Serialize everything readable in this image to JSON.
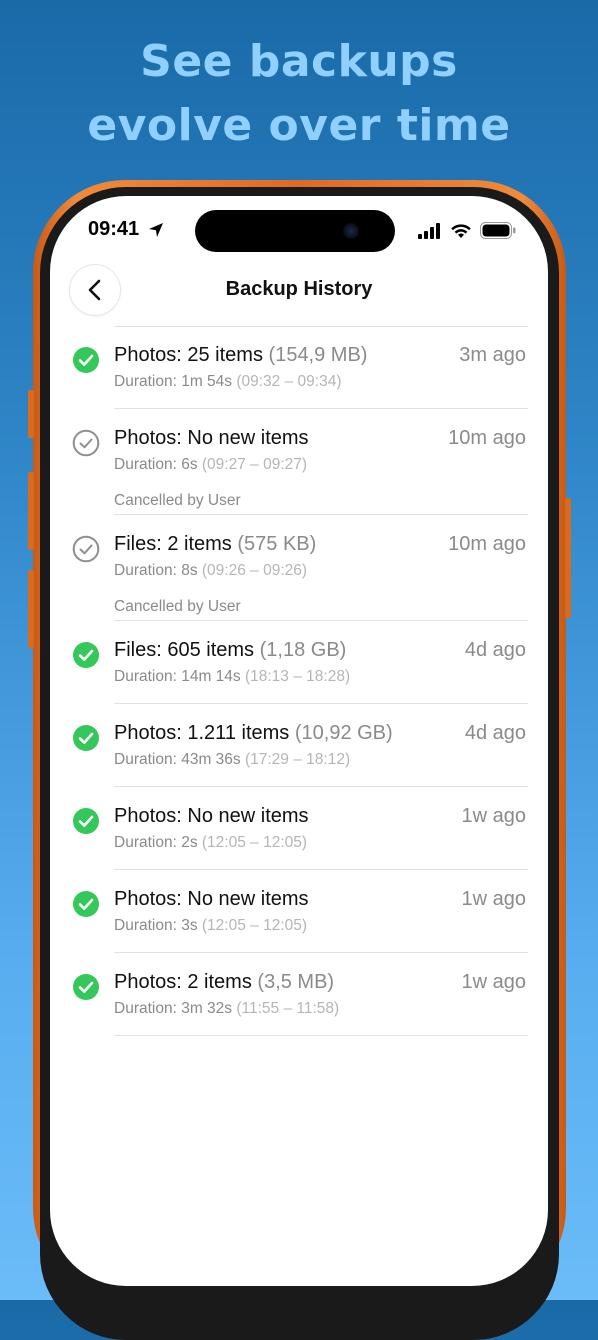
{
  "headline": {
    "line1": "See backups",
    "line2": "evolve over time"
  },
  "status_bar": {
    "time": "09:41",
    "icons": [
      "location-arrow-icon",
      "cellular-signal-icon",
      "wifi-icon",
      "battery-icon"
    ]
  },
  "nav": {
    "back_icon": "chevron-left-icon",
    "title": "Backup History"
  },
  "colors": {
    "success": "#34c759",
    "cancelled": "#8e8e93",
    "phone_frame": "#e9782c",
    "headline": "#8fd0ff"
  },
  "history": [
    {
      "status": "success",
      "title": "Photos: 25 items",
      "size": "(154,9 MB)",
      "ago": "3m ago",
      "duration": "Duration: 1m 54s",
      "range": "(09:32 – 09:34)",
      "note": ""
    },
    {
      "status": "cancelled",
      "title": "Photos: No new items",
      "size": "",
      "ago": "10m ago",
      "duration": "Duration: 6s",
      "range": "(09:27 – 09:27)",
      "note": "Cancelled by User"
    },
    {
      "status": "cancelled",
      "title": "Files: 2 items",
      "size": "(575 KB)",
      "ago": "10m ago",
      "duration": "Duration: 8s",
      "range": "(09:26 – 09:26)",
      "note": "Cancelled by User"
    },
    {
      "status": "success",
      "title": "Files: 605 items",
      "size": "(1,18 GB)",
      "ago": "4d ago",
      "duration": "Duration: 14m 14s",
      "range": "(18:13 – 18:28)",
      "note": ""
    },
    {
      "status": "success",
      "title": "Photos: 1.211 items",
      "size": "(10,92 GB)",
      "ago": "4d ago",
      "duration": "Duration: 43m 36s",
      "range": "(17:29 – 18:12)",
      "note": ""
    },
    {
      "status": "success",
      "title": "Photos: No new items",
      "size": "",
      "ago": "1w ago",
      "duration": "Duration: 2s",
      "range": "(12:05 – 12:05)",
      "note": ""
    },
    {
      "status": "success",
      "title": "Photos: No new items",
      "size": "",
      "ago": "1w ago",
      "duration": "Duration: 3s",
      "range": "(12:05 – 12:05)",
      "note": ""
    },
    {
      "status": "success",
      "title": "Photos: 2 items",
      "size": "(3,5 MB)",
      "ago": "1w ago",
      "duration": "Duration: 3m 32s",
      "range": "(11:55 – 11:58)",
      "note": ""
    }
  ]
}
